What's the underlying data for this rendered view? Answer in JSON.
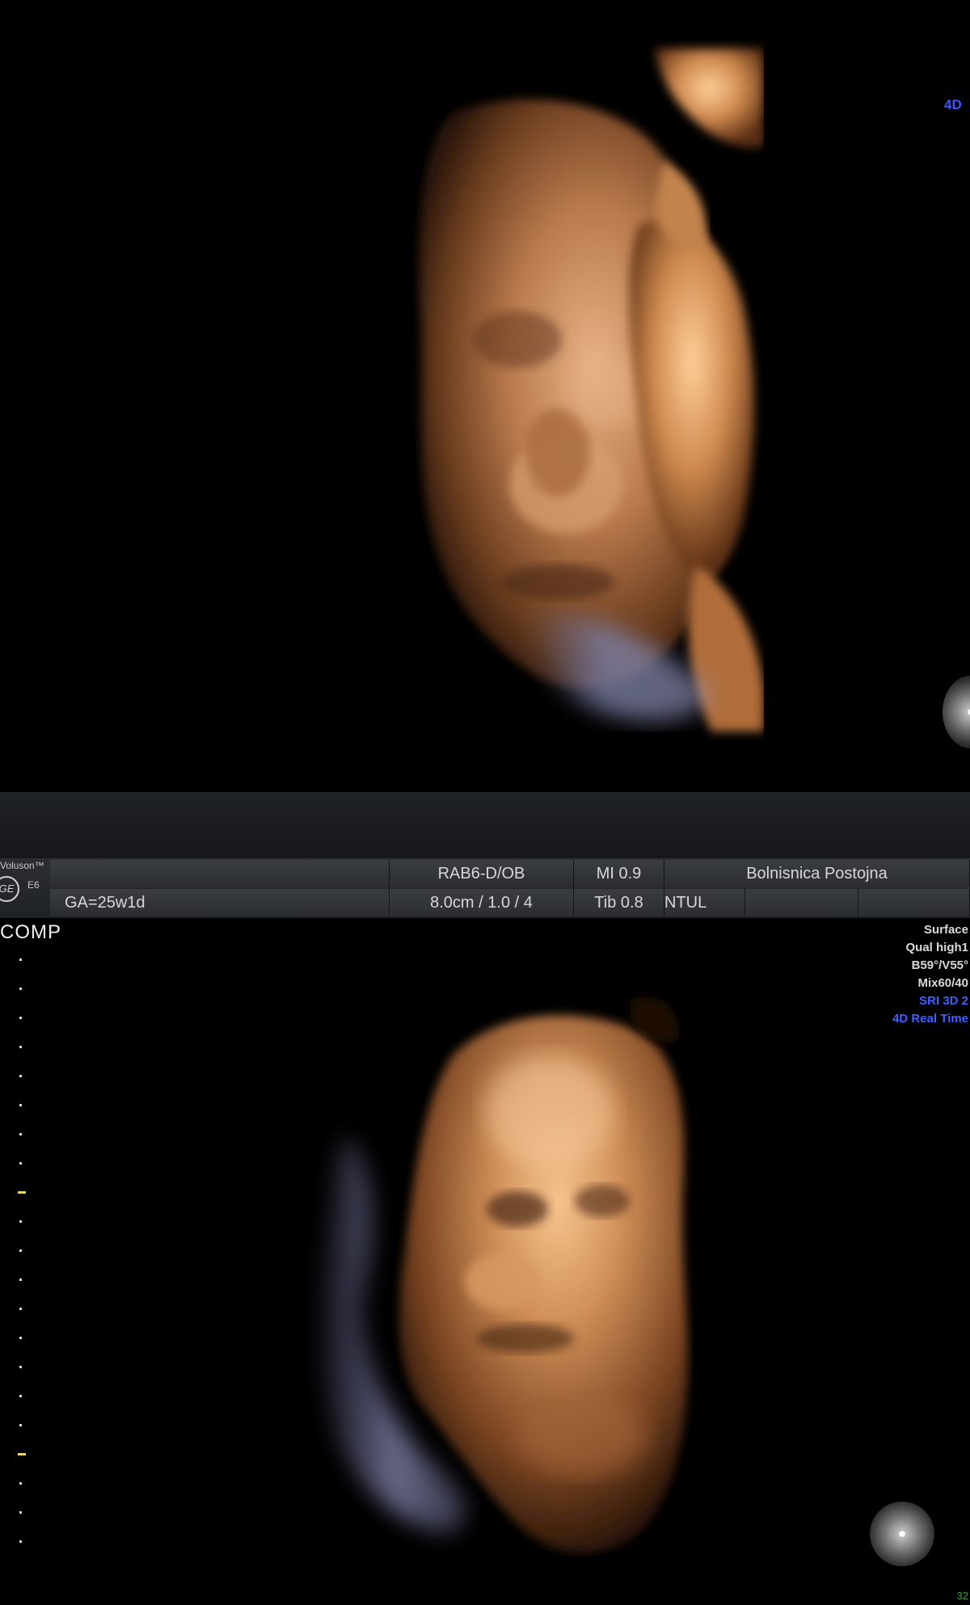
{
  "top_view": {
    "mode_tag": "4D"
  },
  "header": {
    "brand": "Voluson™",
    "logo": "GE",
    "model": "E6",
    "ga": "GA=25w1d",
    "probe": "RAB6-D/OB",
    "depth": "8.0cm / 1.0 / 4",
    "mi": "MI 0.9",
    "tib": "Tib 0.8",
    "tissue": "NTUL",
    "hospital": "Bolnisnica Postojna"
  },
  "bottom_view": {
    "mode": "COMP",
    "params": {
      "render_mode": "Surface",
      "quality": "Qual high1",
      "angles": "B59°/V55°",
      "mix": "Mix60/40",
      "sri": "SRI 3D 2",
      "realtime": "4D Real Time"
    },
    "frame_number": "32"
  },
  "icons": {
    "trackball_top": "trackball-icon",
    "trackball_bottom": "trackball-icon",
    "logo": "ge-logo-icon"
  },
  "colors": {
    "render_tone": "#c7895a",
    "highlight_tone": "#f3c28f",
    "blue_param": "#4060ff",
    "header_bg": "#2b2e33"
  }
}
